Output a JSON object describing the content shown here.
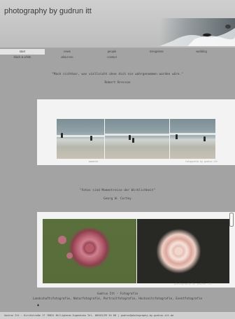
{
  "header": {
    "title": "photography by gudrun itt"
  },
  "nav": {
    "row1": [
      "start",
      "news",
      "people",
      "Ereignisse",
      "wedding"
    ],
    "row2": [
      "black & white",
      "about me",
      "contact"
    ],
    "active": "start"
  },
  "quotes": [
    {
      "text": "\"Mach sichtbar, was vielleicht ohne dich nie wahrgenommen worden wäre.\"",
      "author": "Robert Bresson"
    },
    {
      "text": "\"Fotos sind Momentreise der Wirklichkeit\"",
      "author": "Georg W. Cortey"
    }
  ],
  "panel1": {
    "caption_left": "momente",
    "caption_right": "fotografie by gudrun itt"
  },
  "panel2": {
    "watermark": "photography by gudrun itt"
  },
  "footer": {
    "line1": "Gudrun Itt - Fotografie",
    "line2": "Landschaftsfotografie, Naturfotografie, Portraitfotografie, Hochzeitsfotografie, Eventfotografie",
    "bottom": "Gudrun Itt · Kirchstraße 17 76831 Billigheim-Ingenheim Tel. 06349/99 34 80 | gudrun@photography-by-gudrun-itt.de"
  },
  "colors": {
    "background": "#a3a3a3",
    "header": "#cfcfcf",
    "panel": "#f3f3f3"
  }
}
